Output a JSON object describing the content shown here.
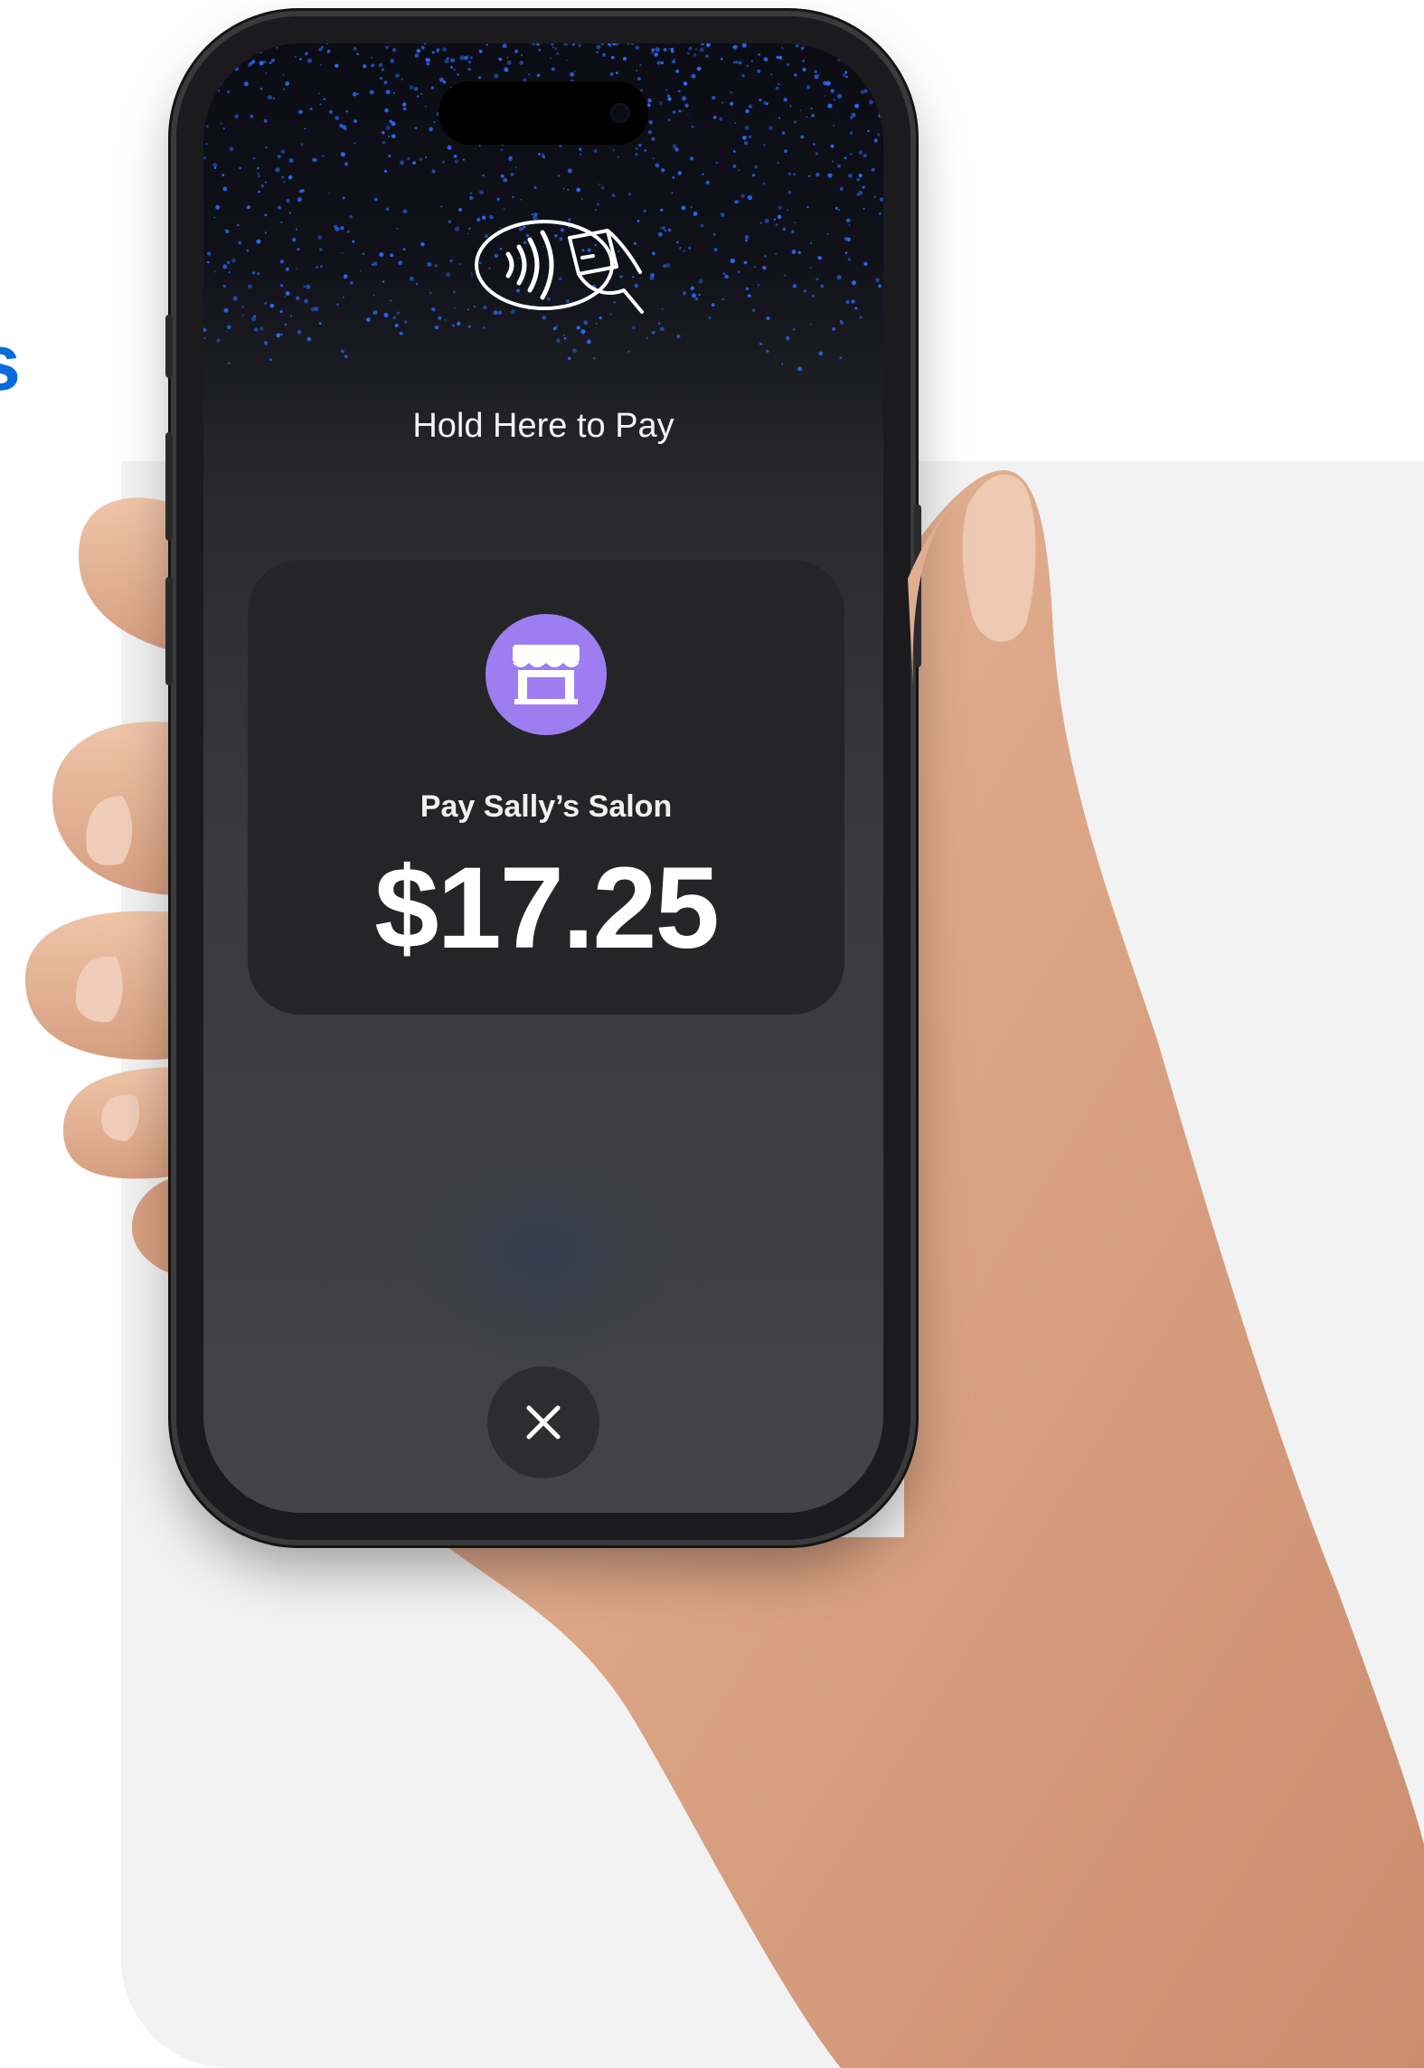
{
  "screen": {
    "hold_text": "Hold Here to Pay",
    "merchant": {
      "label": "Pay Sally’s Salon",
      "icon": "storefront-icon",
      "avatar_color": "#9d7df0"
    },
    "amount": "$17.25",
    "contactless_icon": "contactless-payment-icon",
    "close_icon": "close-icon"
  },
  "colors": {
    "accent_blue": "#0a6bdc",
    "sparkle_blue": "#2d6bff",
    "background_panel": "#f2f2f2"
  }
}
